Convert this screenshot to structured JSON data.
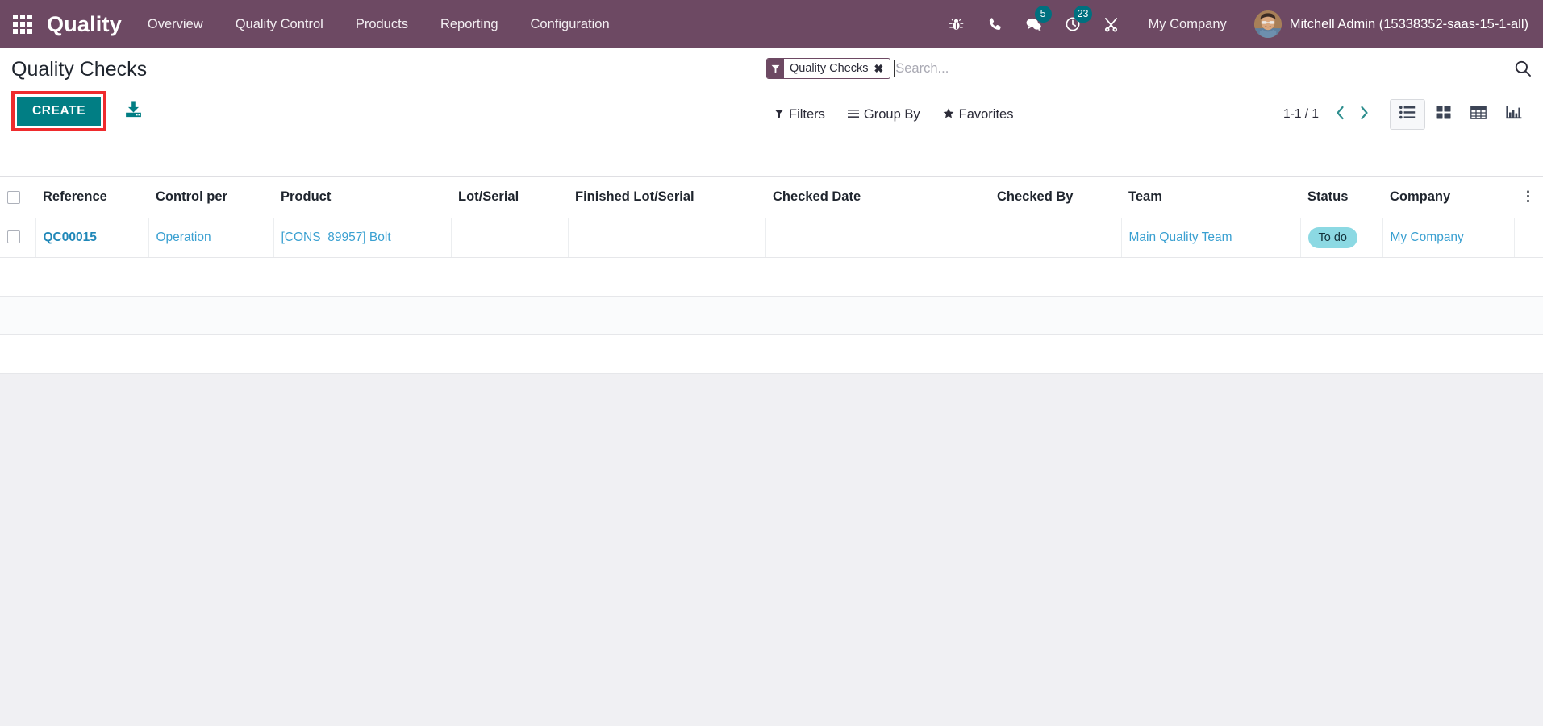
{
  "navbar": {
    "apps_icon": "apps-grid-icon",
    "brand": "Quality",
    "menu_items": [
      {
        "label": "Overview"
      },
      {
        "label": "Quality Control"
      },
      {
        "label": "Products"
      },
      {
        "label": "Reporting"
      },
      {
        "label": "Configuration"
      }
    ],
    "sys_icons": [
      {
        "name": "bug-icon",
        "badge": ""
      },
      {
        "name": "phone-icon",
        "badge": ""
      },
      {
        "name": "messages-icon",
        "badge": "5"
      },
      {
        "name": "activity-clock-icon",
        "badge": "23"
      },
      {
        "name": "tools-icon",
        "badge": ""
      }
    ],
    "company": "My Company",
    "user": "Mitchell Admin (15338352-saas-15-1-all)",
    "bg_color": "#6d4963"
  },
  "control_panel": {
    "title": "Quality Checks",
    "create_label": "CREATE",
    "create_accent": "#017e84",
    "highlight_color": "#ef2b2d",
    "import_icon": "import-download-icon",
    "search": {
      "facet_label": "Quality Checks",
      "facet_icon": "filter-funnel-icon",
      "facet_close": "✖",
      "placeholder": "Search...",
      "value": "",
      "magnifier_icon": "search-icon"
    },
    "filters_label": "Filters",
    "groupby_label": "Group By",
    "favorites_label": "Favorites",
    "pager_text": "1-1 / 1",
    "prev_icon": "chevron-left-icon",
    "next_icon": "chevron-right-icon",
    "views": [
      {
        "name": "list-view",
        "icon": "list-icon",
        "active": true
      },
      {
        "name": "kanban-view",
        "icon": "kanban-icon",
        "active": false
      },
      {
        "name": "pivot-view",
        "icon": "pivot-table-icon",
        "active": false
      },
      {
        "name": "graph-view",
        "icon": "bar-chart-icon",
        "active": false
      }
    ]
  },
  "table": {
    "columns": [
      "Reference",
      "Control per",
      "Product",
      "Lot/Serial",
      "Finished Lot/Serial",
      "Checked Date",
      "Checked By",
      "Team",
      "Status",
      "Company"
    ],
    "optional_columns_icon": "vertical-dots-icon",
    "rows": [
      {
        "reference": "QC00015",
        "control_per": "Operation",
        "product": "[CONS_89957] Bolt",
        "lot_serial": "",
        "finished_lot_serial": "",
        "checked_date": "",
        "checked_by": "",
        "team": "Main Quality Team",
        "status": "To do",
        "company": "My Company"
      }
    ],
    "status_badge_color": "#8cd9e3",
    "link_color": "#3aa0d1"
  }
}
